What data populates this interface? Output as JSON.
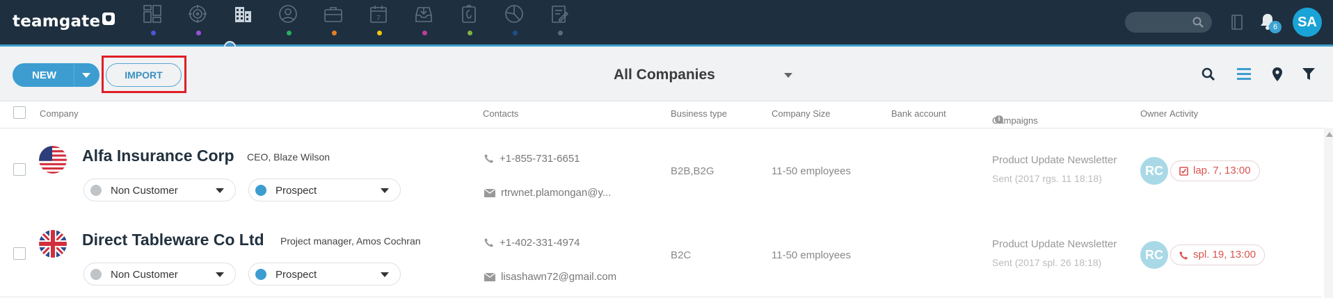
{
  "brand": {
    "name": "teamgate",
    "accent": "#3a9fcc",
    "bar_bg": "#1e2f3f"
  },
  "nav": [
    {
      "icon": "dashboard-icon",
      "dot": "#4d55d6"
    },
    {
      "icon": "target-icon",
      "dot": "#9b4fd6"
    },
    {
      "icon": "companies-icon",
      "dot": "",
      "active": true
    },
    {
      "icon": "person-icon",
      "dot": "#27ae60"
    },
    {
      "icon": "briefcase-icon",
      "dot": "#e67e22"
    },
    {
      "icon": "calendar-icon",
      "dot": "#f1c40f",
      "text": "7"
    },
    {
      "icon": "inbox-download-icon",
      "dot": "#c23b9a"
    },
    {
      "icon": "clipboard-icon",
      "dot": "#7cb342"
    },
    {
      "icon": "pie-chart-icon",
      "dot": "#1f4e8c"
    },
    {
      "icon": "edit-note-icon",
      "dot": "#5a6b78"
    }
  ],
  "topbar": {
    "notifications": "6",
    "avatar_initials": "SA"
  },
  "toolbar": {
    "new_label": "NEW",
    "import_label": "IMPORT",
    "view_title": "All Companies"
  },
  "table": {
    "headers": {
      "company": "Company",
      "contacts": "Contacts",
      "business_type": "Business type",
      "company_size": "Company Size",
      "bank_account": "Bank account",
      "campaigns": "Campaigns",
      "owner": "Owner",
      "activity": "Activity"
    },
    "rows": [
      {
        "flag": "us-flag-icon",
        "name": "Alfa Insurance Corp",
        "role": "CEO, Blaze Wilson",
        "status": "Non Customer",
        "stage": "Prospect",
        "phone": "+1-855-731-6651",
        "email": "rtrwnet.plamongan@y...",
        "business_type": "B2B,B2G",
        "size": "11-50 employees",
        "campaign": "Product Update Newsletter",
        "campaign_sent": "Sent (2017 rgs. 11 18:18)",
        "owner": "RC",
        "activity": "lap. 7, 13:00",
        "activity_icon": "task-check-icon"
      },
      {
        "flag": "uk-flag-icon",
        "name": "Direct Tableware Co Ltd",
        "role": "Project manager, Amos Cochran",
        "status": "Non Customer",
        "stage": "Prospect",
        "phone": "+1-402-331-4974",
        "email": "lisashawn72@gmail.com",
        "business_type": "B2C",
        "size": "11-50 employees",
        "campaign": "Product Update Newsletter",
        "campaign_sent": "Sent (2017 spl. 26 18:18)",
        "owner": "RC",
        "activity": "spl. 19, 13:00",
        "activity_icon": "phone-icon"
      }
    ]
  },
  "colors": {
    "non_customer": "#bfc4c9",
    "prospect": "#3d9dd1",
    "activity_red": "#d9534f",
    "owner_bg": "#a9d9e6"
  }
}
